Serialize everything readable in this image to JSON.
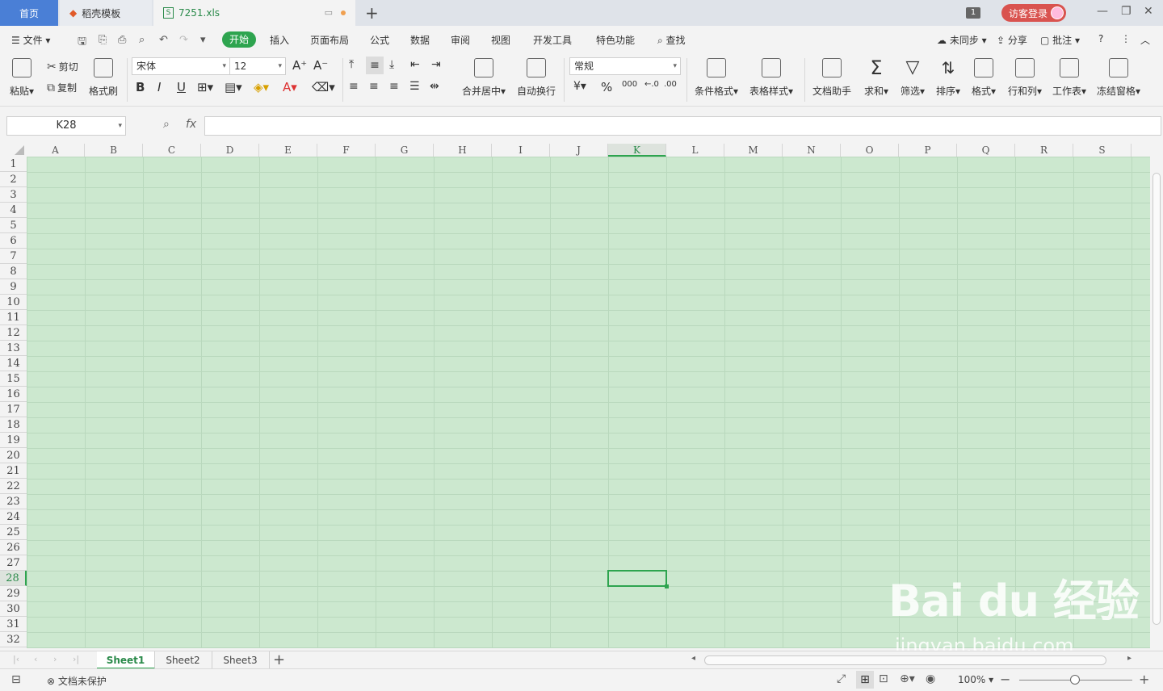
{
  "tabs": {
    "home": "首页",
    "daoke": "稻壳模板",
    "file": "7251.xls",
    "window_count": "1",
    "login": "访客登录"
  },
  "menu": {
    "file": "文件",
    "start": "开始",
    "insert": "插入",
    "page_layout": "页面布局",
    "formula": "公式",
    "data": "数据",
    "review": "审阅",
    "view": "视图",
    "developer": "开发工具",
    "special": "特色功能",
    "find": "查找",
    "sync": "未同步",
    "share": "分享",
    "comment": "批注"
  },
  "ribbon": {
    "paste": "粘贴",
    "cut": "剪切",
    "copy": "复制",
    "format_painter": "格式刷",
    "font_name": "宋体",
    "font_size": "12",
    "merge_center": "合并居中",
    "wrap": "自动换行",
    "number_format": "常规",
    "cond_format": "条件格式",
    "table_style": "表格样式",
    "doc_assistant": "文档助手",
    "sum": "求和",
    "filter": "筛选",
    "sort": "排序",
    "format": "格式",
    "row_col": "行和列",
    "worksheet": "工作表",
    "freeze": "冻结窗格"
  },
  "formula_bar": {
    "name_box": "K28",
    "fx": "fx",
    "value": ""
  },
  "grid": {
    "columns": [
      "A",
      "B",
      "C",
      "D",
      "E",
      "F",
      "G",
      "H",
      "I",
      "J",
      "K",
      "L",
      "M",
      "N",
      "O",
      "P",
      "Q",
      "R",
      "S"
    ],
    "rows": [
      "1",
      "2",
      "3",
      "4",
      "5",
      "6",
      "7",
      "8",
      "9",
      "10",
      "11",
      "12",
      "13",
      "14",
      "15",
      "16",
      "17",
      "18",
      "19",
      "20",
      "21",
      "22",
      "23",
      "24",
      "25",
      "26",
      "27",
      "28",
      "29",
      "30",
      "31",
      "32"
    ],
    "selected_column": "K",
    "selected_row": "28"
  },
  "sheets": [
    "Sheet1",
    "Sheet2",
    "Sheet3"
  ],
  "active_sheet": "Sheet1",
  "status": {
    "protect": "文档未保护",
    "zoom": "100%"
  },
  "watermark": {
    "main": "Bai du 经验",
    "sub": "jingyan.baidu.com"
  },
  "colors": {
    "accent": "#2ea44f",
    "cell_bg": "#cce8cf",
    "home_tab": "#4a7fd6",
    "login": "#d9534f"
  }
}
